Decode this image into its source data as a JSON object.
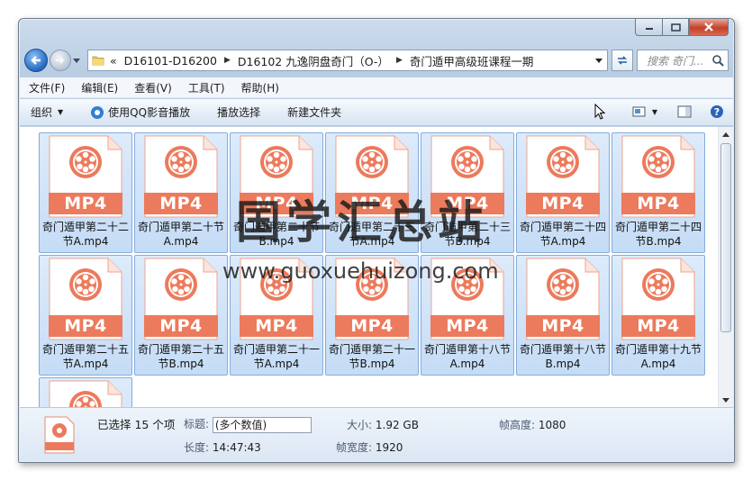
{
  "window": {
    "minimize_icon": "minimize-icon",
    "maximize_icon": "maximize-icon",
    "close_icon": "close-icon"
  },
  "address": {
    "overflow": "«",
    "crumbs": [
      "D16101-D16200",
      "D16102 九逸阴盘奇门（O-）",
      "奇门遁甲高级班课程一期"
    ],
    "search_placeholder": "搜索 奇门..."
  },
  "menu": [
    "文件(F)",
    "编辑(E)",
    "查看(V)",
    "工具(T)",
    "帮助(H)"
  ],
  "commands": {
    "organize": "组织",
    "play_qq": "使用QQ影音播放",
    "play_selection": "播放选择",
    "new_folder": "新建文件夹"
  },
  "files": {
    "badge": "MP4",
    "items": [
      "奇门遁甲第二十二节A.mp4",
      "奇门遁甲第二十节A.mp4",
      "奇门遁甲第二十节B.mp4",
      "奇门遁甲第二十三节A.mp4",
      "奇门遁甲第二十三节B.mp4",
      "奇门遁甲第二十四节A.mp4",
      "奇门遁甲第二十四节B.mp4",
      "奇门遁甲第二十五节A.mp4",
      "奇门遁甲第二十五节B.mp4",
      "奇门遁甲第二十一节A.mp4",
      "奇门遁甲第二十一节B.mp4",
      "奇门遁甲第十八节A.mp4",
      "奇门遁甲第十八节B.mp4",
      "奇门遁甲第十九节A.mp4",
      ""
    ]
  },
  "details": {
    "selected": "已选择 15 个项",
    "title_label": "标题:",
    "title_value": "(多个数值)",
    "size_label": "大小:",
    "size_value": "1.92 GB",
    "frame_height_label": "帧高度:",
    "frame_height_value": "1080",
    "length_label": "长度:",
    "length_value": "14:47:43",
    "frame_width_label": "帧宽度:",
    "frame_width_value": "1920"
  },
  "watermark": {
    "title": "国学汇总站",
    "url": "www.guoxuehuizong.com"
  },
  "colors": {
    "badge": "#ec7a5c",
    "selection": "#cfe3fa",
    "selection_border": "#84acdd"
  }
}
